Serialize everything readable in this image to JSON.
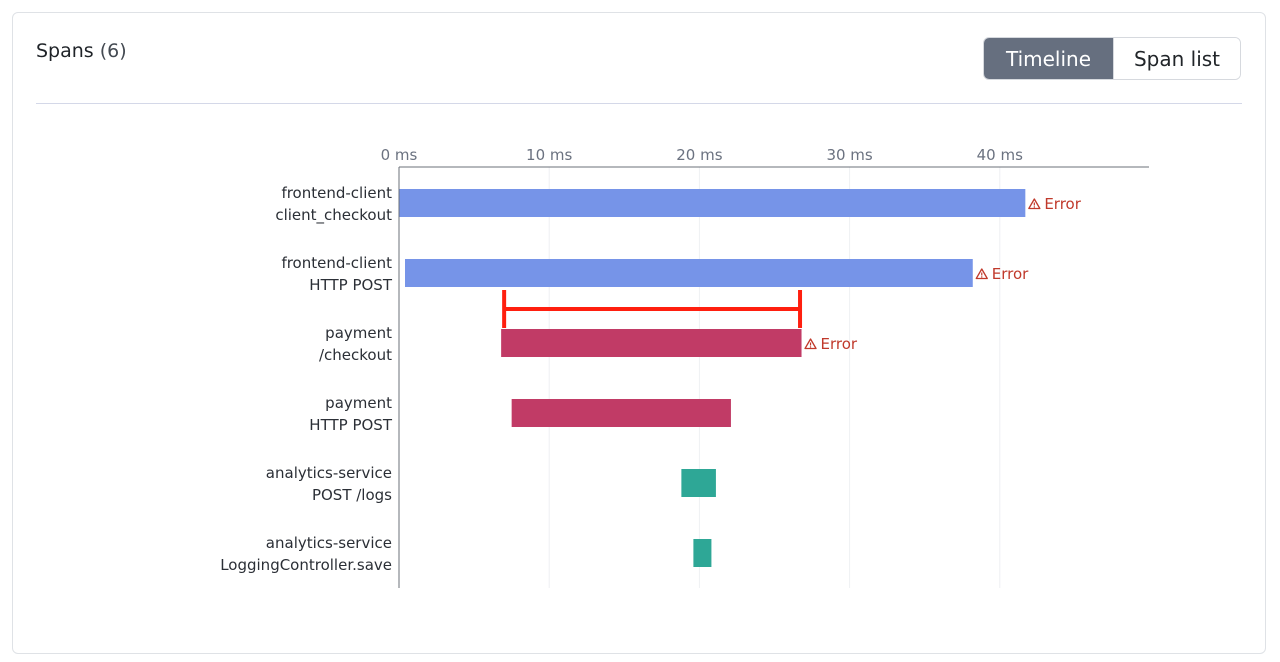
{
  "panel": {
    "title": "Spans",
    "count": "(6)"
  },
  "view_toggle": {
    "timeline_label": "Timeline",
    "span_list_label": "Span list",
    "active": "Timeline"
  },
  "colors": {
    "frontend-client": "#7694e8",
    "payment": "#c13b66",
    "analytics-service": "#2ea796",
    "error_text": "#c0392b",
    "highlight": "#ff1f0f"
  },
  "chart_data": {
    "type": "gantt",
    "unit": "ms",
    "xlim": [
      0,
      50
    ],
    "ticks": [
      0,
      10,
      20,
      30,
      40
    ],
    "tick_labels": [
      "0 ms",
      "10 ms",
      "20 ms",
      "30 ms",
      "40 ms"
    ],
    "grid": true,
    "error_label": "Error",
    "spans": [
      {
        "service": "frontend-client",
        "operation": "client_checkout",
        "start": 0,
        "end": 41.7,
        "error": true
      },
      {
        "service": "frontend-client",
        "operation": "HTTP POST",
        "start": 0.4,
        "end": 38.2,
        "error": true
      },
      {
        "service": "payment",
        "operation": "/checkout",
        "start": 6.8,
        "end": 26.8,
        "error": true
      },
      {
        "service": "payment",
        "operation": "HTTP POST",
        "start": 7.5,
        "end": 22.1,
        "error": false
      },
      {
        "service": "analytics-service",
        "operation": "POST /logs",
        "start": 18.8,
        "end": 21.1,
        "error": false
      },
      {
        "service": "analytics-service",
        "operation": "LoggingController.save",
        "start": 19.6,
        "end": 20.8,
        "error": false
      }
    ],
    "highlight_interval": {
      "start": 7.0,
      "end": 26.7
    }
  }
}
